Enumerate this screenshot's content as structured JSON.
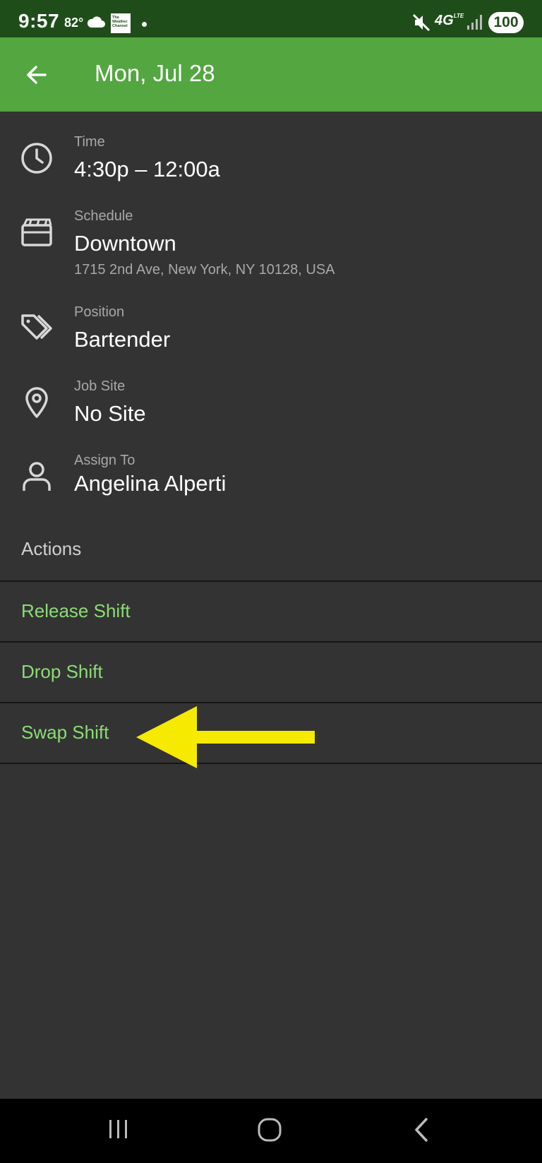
{
  "status_bar": {
    "time": "9:57",
    "temperature": "82°",
    "weather_app_badge": "The Weather Channel",
    "network": "4G",
    "network_suffix": "LTE",
    "battery": "100"
  },
  "header": {
    "title": "Mon, Jul 28",
    "background_color": "#53a640"
  },
  "details": {
    "time": {
      "label": "Time",
      "value": "4:30p – 12:00a",
      "icon": "clock-icon"
    },
    "schedule": {
      "label": "Schedule",
      "value": "Downtown",
      "address": "1715 2nd Ave, New York, NY 10128, USA",
      "icon": "schedule-icon"
    },
    "position": {
      "label": "Position",
      "value": "Bartender",
      "icon": "tag-icon"
    },
    "job_site": {
      "label": "Job Site",
      "value": "No Site",
      "icon": "location-pin-icon"
    },
    "assign_to": {
      "label": "Assign To",
      "value": "Angelina Alperti",
      "icon": "person-icon"
    }
  },
  "actions": {
    "header": "Actions",
    "items": [
      {
        "label": "Release Shift"
      },
      {
        "label": "Drop Shift"
      },
      {
        "label": "Swap Shift"
      }
    ],
    "accent_color": "#8bdc74"
  },
  "annotation": {
    "arrow_color": "#f5ea00",
    "points_to": "Swap Shift"
  }
}
